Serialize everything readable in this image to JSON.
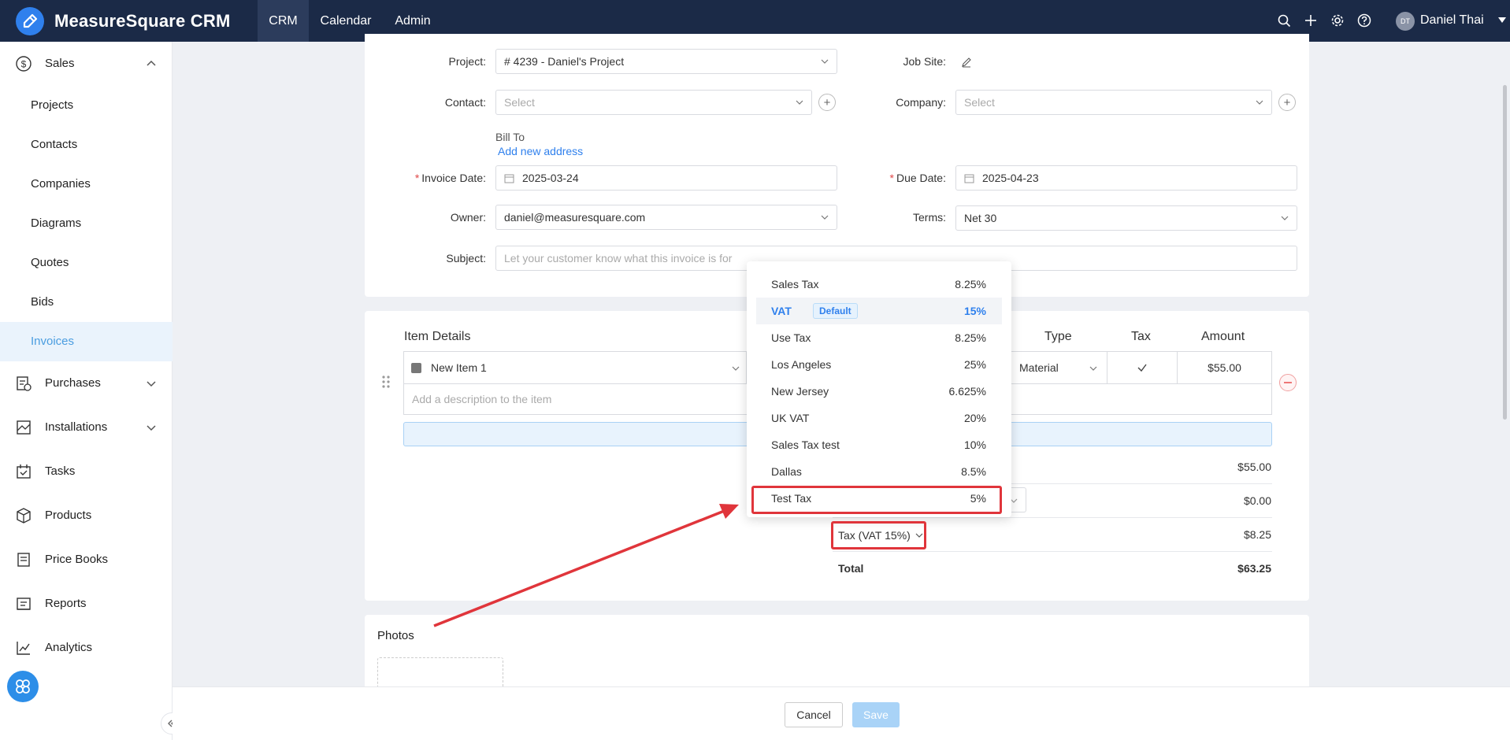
{
  "app": {
    "brand": "MeasureSquare CRM"
  },
  "topnav": [
    {
      "label": "CRM"
    },
    {
      "label": "Calendar"
    },
    {
      "label": "Admin"
    }
  ],
  "user": {
    "initials": "DT",
    "name": "Daniel Thai"
  },
  "sidebar": {
    "sales": "Sales",
    "sales_items": [
      "Projects",
      "Contacts",
      "Companies",
      "Diagrams",
      "Quotes",
      "Bids",
      "Invoices"
    ],
    "purchases": "Purchases",
    "installations": "Installations",
    "tasks": "Tasks",
    "products": "Products",
    "price_books": "Price Books",
    "reports": "Reports",
    "analytics": "Analytics"
  },
  "form": {
    "project_label": "Project:",
    "project_value": "# 4239 - Daniel's Project",
    "job_site_label": "Job Site:",
    "contact_label": "Contact:",
    "contact_placeholder": "Select",
    "company_label": "Company:",
    "company_placeholder": "Select",
    "bill_to_label": "Bill To",
    "add_address": "Add new address",
    "invoice_date_label": "Invoice Date:",
    "invoice_date": "2025-03-24",
    "due_date_label": "Due Date:",
    "due_date": "2025-04-23",
    "owner_label": "Owner:",
    "owner_value": "daniel@measuresquare.com",
    "terms_label": "Terms:",
    "terms_value": "Net 30",
    "subject_label": "Subject:",
    "subject_placeholder": "Let your customer know what this invoice is for"
  },
  "items": {
    "title": "Item Details",
    "col_type": "Type",
    "col_tax": "Tax",
    "col_amount": "Amount",
    "row": {
      "name": "New Item 1",
      "type": "Material",
      "amount": "$55.00",
      "description_placeholder": "Add a description to the item"
    }
  },
  "totals": {
    "subtotal": "$55.00",
    "discount": "$0.00",
    "tax_selector": "Tax (VAT 15%)",
    "tax_amount": "$8.25",
    "total_label": "Total",
    "total_value": "$63.25"
  },
  "tax_options": [
    {
      "name": "Sales Tax",
      "rate": "8.25%"
    },
    {
      "name": "VAT",
      "rate": "15%",
      "badge": "Default"
    },
    {
      "name": "Use Tax",
      "rate": "8.25%"
    },
    {
      "name": "Los Angeles",
      "rate": "25%"
    },
    {
      "name": "New Jersey",
      "rate": "6.625%"
    },
    {
      "name": "UK VAT",
      "rate": "20%"
    },
    {
      "name": "Sales Tax test",
      "rate": "10%"
    },
    {
      "name": "Dallas",
      "rate": "8.5%"
    },
    {
      "name": "Test Tax",
      "rate": "5%"
    }
  ],
  "photos": {
    "title": "Photos"
  },
  "footer": {
    "cancel": "Cancel",
    "save": "Save"
  },
  "colors": {
    "topbar": "#1b2a47",
    "accent": "#2f80ed",
    "highlight": "#e0353b"
  }
}
